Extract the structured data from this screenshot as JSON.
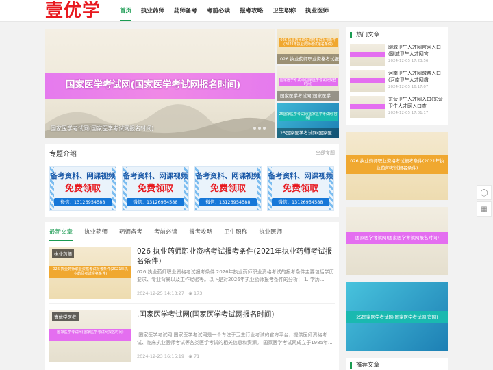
{
  "header": {
    "logo": "壹优学",
    "nav": [
      "首页",
      "执业药师",
      "药师备考",
      "考前必读",
      "报考攻略",
      "卫生职称",
      "执业医师"
    ],
    "active_index": 0,
    "accent": "#1a9b52"
  },
  "slider": {
    "banner_text": "国家医学考试网(国家医学考试网报名时间)",
    "caption": "国家医学考试网(国家医学考试网报名时间)",
    "thumbs": [
      {
        "banner": "026 执业药师职业资格考试报考条件(2021年执业药师考试报名条件)",
        "caption": "026 执业药师职业资格考试报考..."
      },
      {
        "banner": "国家医学考试网(国家医学考试网报名时间)",
        "caption": "国家医学考试网(国家医学..."
      },
      {
        "banner": "25国家医学考试网(国家医学考试网 官网)",
        "caption": "25国家医学考试网(国家医..."
      }
    ]
  },
  "topics": {
    "title": "专题介绍",
    "more": "全部专题",
    "promo": {
      "line1": "备考资料、网课视频",
      "line2": "免费领取",
      "line3": "微信：13126954588"
    }
  },
  "list": {
    "tabs": [
      "最新文章",
      "执业药师",
      "药师备考",
      "考前必读",
      "报考攻略",
      "卫生职称",
      "执业医师"
    ],
    "active_tab": 0,
    "articles": [
      {
        "category": "执业药师",
        "banner": "026 执业药师职业资格考试报考条件(2021年执业药师考试报名条件)",
        "title": "026 执业药师职业资格考试报考条件(2021年执业药师考试报名条件)",
        "desc": "026 执业药师职业资格考试报考条件 2026年执业药师职业资格考试的报考条件主要包括学历要求、专业背景以及工作经验等。以下是对2026年执业药师报考条件的分析： 1. 学历...",
        "date": "2024-12-25 14:13:27",
        "views": "173"
      },
      {
        "category": "壹优学医考",
        "banner": "国家医学考试网(国家医学考试网报名时间)",
        "title": ".国家医学考试网(国家医学考试网报名时间)",
        "desc": ".国家医学考试网 国家医学考试网是一个专注于卫生行业考试的官方平台，提供医师资格考试、临床执业医师考试等各类医学考试的相关信息和资源。 国家医学考试网成立于1985年...",
        "date": "2024-12-23 16:15:19",
        "views": "71"
      }
    ]
  },
  "hot": {
    "title": "热门文章",
    "items": [
      {
        "title": "聊城卫生人才网官网入口(聊城卫生人才网官",
        "date": "2024-12-05 17:23:56"
      },
      {
        "title": "河南卫生人才网缴费入口(河南卫生人才网缴",
        "date": "2024-12-05 16:17:07"
      },
      {
        "title": "东营卫生人才网入口(东营卫生人才网入口查",
        "date": "2024-12-05 17:01:17"
      }
    ]
  },
  "ads": [
    {
      "text": "026 执业药师职业资格考试报考条件(2021年执业药师考试报名条件)"
    },
    {
      "text": "国家医学考试网(国家医学考试网报名时间)"
    },
    {
      "text": "25国家医学考试网(国家医学考试网 官网)"
    }
  ],
  "recommend": {
    "title": "推荐文章"
  },
  "float_tools": [
    "chat-icon",
    "qrcode-icon"
  ]
}
